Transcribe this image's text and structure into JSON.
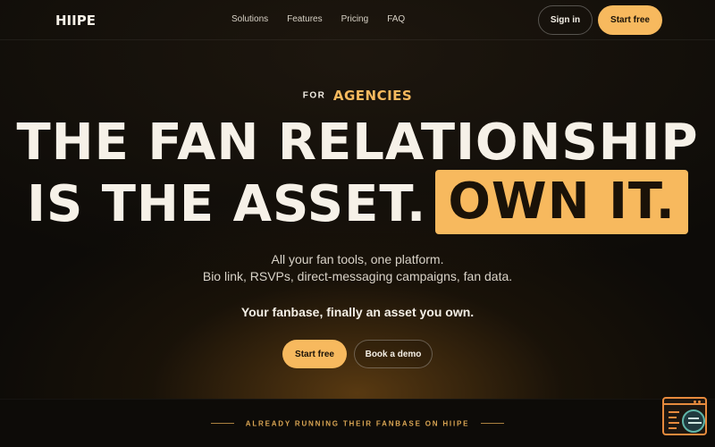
{
  "nav": {
    "logo": "HIIPE",
    "links": [
      "Solutions",
      "Features",
      "Pricing",
      "FAQ"
    ],
    "sign_in": "Sign in",
    "start_free": "Start free"
  },
  "hero": {
    "eyebrow_prefix": "FOR",
    "eyebrow_accent": "AGENCIES",
    "headline_line1": "THE FAN RELATIONSHIP",
    "headline_line2": "IS THE ASSET.",
    "headline_highlight": "OWN IT.",
    "subtitle_line1": "All your fan tools, one platform.",
    "subtitle_line2": "Bio link, RSVPs, direct-messaging campaigns, fan data.",
    "tagline": "Your fanbase, finally an asset you own.",
    "cta_primary": "Start free",
    "cta_secondary": "Book a demo"
  },
  "social_proof": {
    "label": "ALREADY RUNNING THEIR FANBASE ON HIIPE"
  },
  "chat_widget": {
    "icon": "chat-widget-icon"
  },
  "colors": {
    "accent": "#f7b95e",
    "background": "#0d0b08",
    "text": "#f2ede4",
    "widget_border": "#e78a3d"
  }
}
